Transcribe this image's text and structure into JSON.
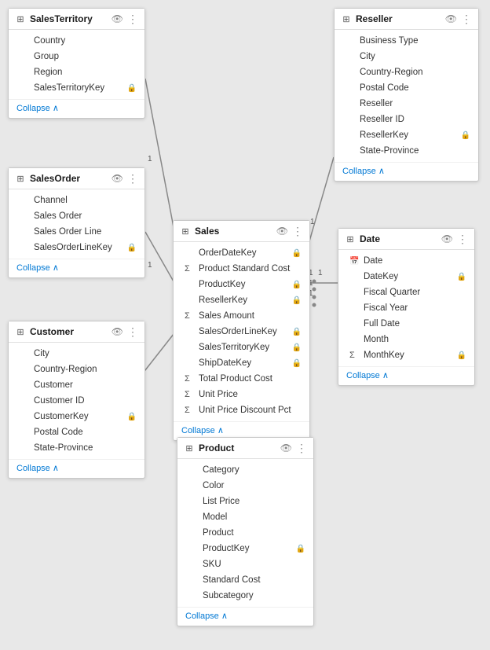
{
  "tables": {
    "salesTerritory": {
      "title": "SalesTerritory",
      "icon": "table",
      "fields": [
        {
          "prefix": "",
          "name": "Country"
        },
        {
          "prefix": "",
          "name": "Group"
        },
        {
          "prefix": "",
          "name": "Region"
        },
        {
          "prefix": "",
          "name": "SalesTerritoryKey",
          "keyIcon": true
        }
      ],
      "collapse": "Collapse"
    },
    "salesOrder": {
      "title": "SalesOrder",
      "icon": "table",
      "fields": [
        {
          "prefix": "",
          "name": "Channel"
        },
        {
          "prefix": "",
          "name": "Sales Order"
        },
        {
          "prefix": "",
          "name": "Sales Order Line"
        },
        {
          "prefix": "",
          "name": "SalesOrderLineKey",
          "keyIcon": true
        }
      ],
      "collapse": "Collapse"
    },
    "customer": {
      "title": "Customer",
      "icon": "table",
      "fields": [
        {
          "prefix": "",
          "name": "City"
        },
        {
          "prefix": "",
          "name": "Country-Region"
        },
        {
          "prefix": "",
          "name": "Customer"
        },
        {
          "prefix": "",
          "name": "Customer ID"
        },
        {
          "prefix": "",
          "name": "CustomerKey",
          "keyIcon": true
        },
        {
          "prefix": "",
          "name": "Postal Code"
        },
        {
          "prefix": "",
          "name": "State-Province"
        }
      ],
      "collapse": "Collapse"
    },
    "reseller": {
      "title": "Reseller",
      "icon": "table",
      "fields": [
        {
          "prefix": "",
          "name": "Business Type"
        },
        {
          "prefix": "",
          "name": "City"
        },
        {
          "prefix": "",
          "name": "Country-Region"
        },
        {
          "prefix": "",
          "name": "Postal Code"
        },
        {
          "prefix": "",
          "name": "Reseller"
        },
        {
          "prefix": "",
          "name": "Reseller ID"
        },
        {
          "prefix": "",
          "name": "ResellerKey",
          "keyIcon": true
        },
        {
          "prefix": "",
          "name": "State-Province"
        }
      ],
      "collapse": "Collapse"
    },
    "sales": {
      "title": "Sales",
      "icon": "table",
      "fields": [
        {
          "prefix": "",
          "name": "OrderDateKey",
          "keyIcon": true
        },
        {
          "prefix": "Σ",
          "name": "Product Standard Cost"
        },
        {
          "prefix": "",
          "name": "ProductKey",
          "keyIcon": true
        },
        {
          "prefix": "",
          "name": "ResellerKey",
          "keyIcon": true
        },
        {
          "prefix": "Σ",
          "name": "Sales Amount"
        },
        {
          "prefix": "",
          "name": "SalesOrderLineKey",
          "keyIcon": true
        },
        {
          "prefix": "",
          "name": "SalesTerritoryKey",
          "keyIcon": true
        },
        {
          "prefix": "",
          "name": "ShipDateKey",
          "keyIcon": true
        },
        {
          "prefix": "Σ",
          "name": "Total Product Cost"
        },
        {
          "prefix": "Σ",
          "name": "Unit Price"
        },
        {
          "prefix": "Σ",
          "name": "Unit Price Discount Pct"
        }
      ],
      "collapse": "Collapse"
    },
    "date": {
      "title": "Date",
      "icon": "table",
      "fields": [
        {
          "prefix": "cal",
          "name": "Date"
        },
        {
          "prefix": "",
          "name": "DateKey",
          "keyIcon": true
        },
        {
          "prefix": "",
          "name": "Fiscal Quarter"
        },
        {
          "prefix": "",
          "name": "Fiscal Year"
        },
        {
          "prefix": "",
          "name": "Full Date"
        },
        {
          "prefix": "",
          "name": "Month"
        },
        {
          "prefix": "Σ",
          "name": "MonthKey",
          "keyIcon": true
        }
      ],
      "collapse": "Collapse"
    },
    "product": {
      "title": "Product",
      "icon": "table",
      "fields": [
        {
          "prefix": "",
          "name": "Category"
        },
        {
          "prefix": "",
          "name": "Color"
        },
        {
          "prefix": "",
          "name": "List Price"
        },
        {
          "prefix": "",
          "name": "Model"
        },
        {
          "prefix": "",
          "name": "Product"
        },
        {
          "prefix": "",
          "name": "ProductKey",
          "keyIcon": true
        },
        {
          "prefix": "",
          "name": "SKU"
        },
        {
          "prefix": "",
          "name": "Standard Cost"
        },
        {
          "prefix": "",
          "name": "Subcategory"
        }
      ],
      "collapse": "Collapse"
    }
  },
  "icons": {
    "eye": "👁",
    "dots": "⋮",
    "collapseArrow": "∧",
    "tableIcon": "⊞",
    "calendarIcon": "📅",
    "eyeSlash": "🔒"
  },
  "labels": {
    "one": "1",
    "star": "*",
    "dot": "•"
  }
}
